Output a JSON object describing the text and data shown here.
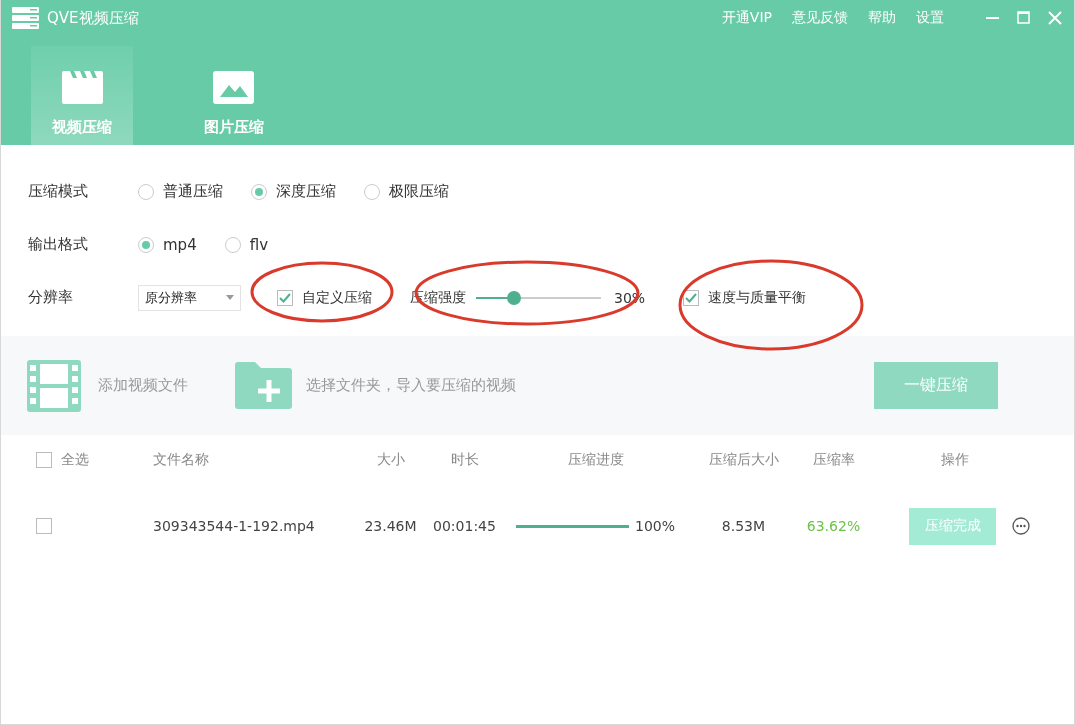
{
  "window": {
    "title": "QVE视频压缩",
    "menu": [
      "开通VIP",
      "意见反馈",
      "帮助",
      "设置"
    ]
  },
  "tabs": [
    {
      "label": "视频压缩",
      "selected": true,
      "kind": "video"
    },
    {
      "label": "图片压缩",
      "selected": false,
      "kind": "image"
    }
  ],
  "settings": {
    "mode": {
      "label": "压缩模式",
      "options": [
        {
          "label": "普通压缩",
          "selected": false
        },
        {
          "label": "深度压缩",
          "selected": true
        },
        {
          "label": "极限压缩",
          "selected": false
        }
      ]
    },
    "format": {
      "label": "输出格式",
      "options": [
        {
          "label": "mp4",
          "selected": true
        },
        {
          "label": "flv",
          "selected": false
        }
      ]
    },
    "resolution": {
      "label": "分辨率",
      "value": "原分辨率"
    },
    "custom": {
      "label": "自定义压缩",
      "checked": true
    },
    "strength": {
      "label": "压缩强度",
      "level": 0.3,
      "reading": "30%"
    },
    "balance": {
      "label": "速度与质量平衡",
      "checked": true
    }
  },
  "toolbar": {
    "add_video": "添加视频文件",
    "add_folder": "选择文件夹，导入要压缩的视频",
    "compress_button": "一键压缩"
  },
  "table": {
    "select_all": {
      "label": "全选",
      "checked": false
    },
    "columns": [
      "文件名称",
      "大小",
      "时长",
      "压缩进度",
      "压缩后大小",
      "压缩率",
      "操作"
    ],
    "rows": [
      {
        "checked": false,
        "name": "309343544-1-192.mp4",
        "size": "23.46M",
        "duration": "00:01:45",
        "level": 1,
        "progress": "100%",
        "compressed_size": "8.53M",
        "rate": "63.62%",
        "action": "压缩完成"
      }
    ]
  }
}
